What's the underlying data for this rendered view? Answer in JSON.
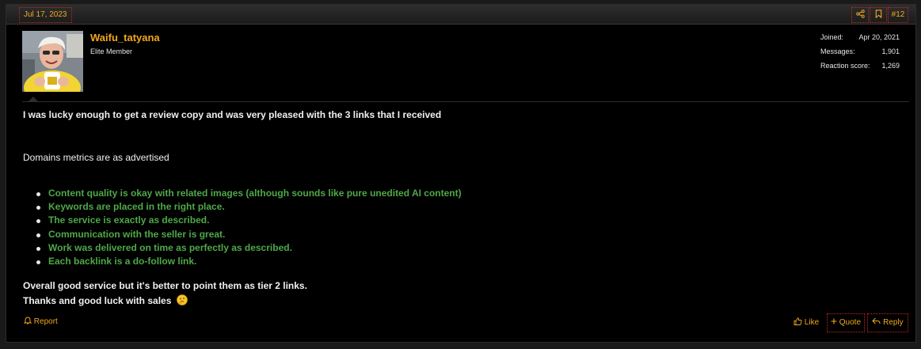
{
  "colors": {
    "accent": "#f2a81d",
    "bullet_text": "#4fa848",
    "focus_border": "#c0281e",
    "background": "#000000"
  },
  "header": {
    "date": "Jul 17, 2023",
    "share_icon": "share-icon",
    "bookmark_icon": "bookmark-icon",
    "post_number": "#12"
  },
  "author": {
    "name": "Waifu_tatyana",
    "title": "Elite Member",
    "stats": [
      {
        "label": "Joined:",
        "value": "Apr 20, 2021"
      },
      {
        "label": "Messages:",
        "value": "1,901"
      },
      {
        "label": "Reaction score:",
        "value": "1,269"
      }
    ]
  },
  "message": {
    "intro": "I was lucky enough to get a review copy and was very pleased with the 3 links that I received",
    "metrics": "Domains metrics are as advertised",
    "bullets": [
      "Content quality is okay with related images (although sounds like pure unedited AI content)",
      "Keywords are placed in the right place.",
      "The service is exactly as described.",
      "Communication with the seller is great.",
      "Work was delivered on time as perfectly as described.",
      "Each backlink is a do-follow link."
    ],
    "closing_1": "Overall good service but it's better to point them as tier 2 links.",
    "closing_2": "Thanks and good luck with sales",
    "emoji": "thinking-face-emoji"
  },
  "footer": {
    "report": "Report",
    "like": "Like",
    "quote": "Quote",
    "reply": "Reply"
  }
}
